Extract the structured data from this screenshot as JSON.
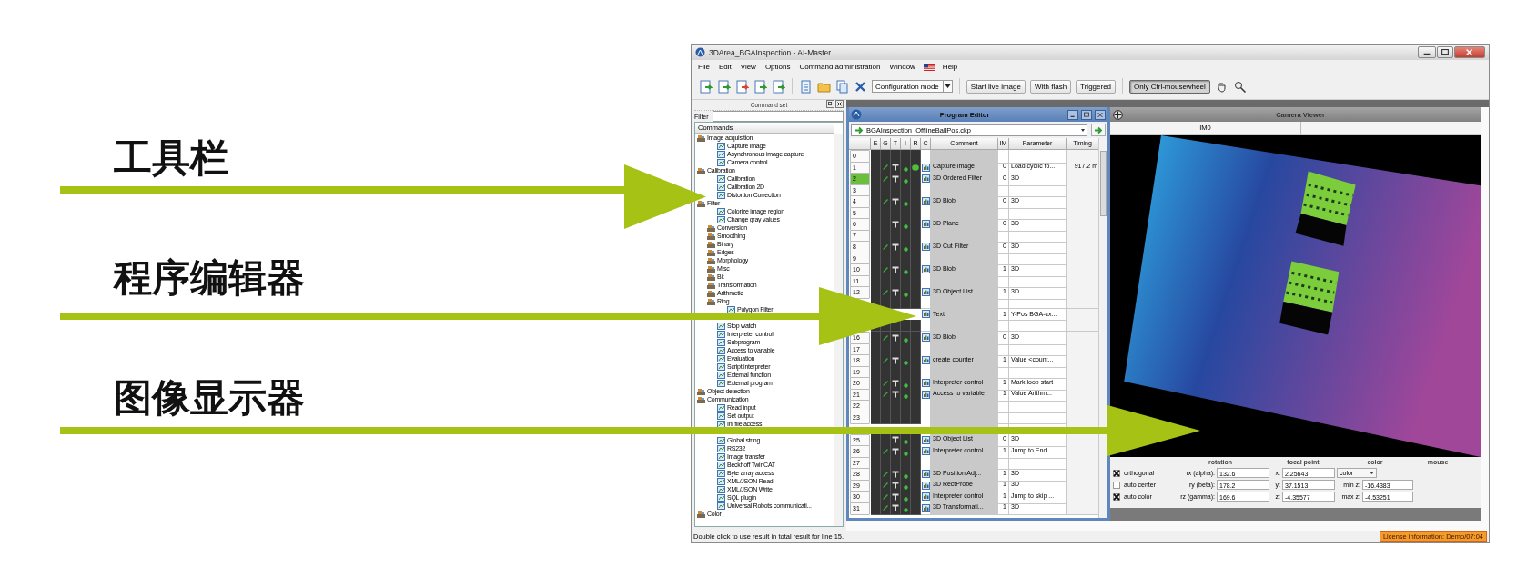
{
  "annotations": [
    {
      "label": "工具栏"
    },
    {
      "label": "程序编辑器"
    },
    {
      "label": "图像显示器"
    }
  ],
  "window": {
    "title": "3DArea_BGAInspection - AI-Master"
  },
  "menu": [
    {
      "kind": "text",
      "label": "File"
    },
    {
      "kind": "text",
      "label": "Edit"
    },
    {
      "kind": "text",
      "label": "View"
    },
    {
      "kind": "text",
      "label": "Options"
    },
    {
      "kind": "text",
      "label": "Command administration"
    },
    {
      "kind": "text",
      "label": "Window"
    },
    {
      "kind": "flag"
    },
    {
      "kind": "text",
      "label": "Help"
    }
  ],
  "toolbar": {
    "mode_select": "Configuration mode",
    "buttons": [
      {
        "label": "Start live image",
        "pressed": false
      },
      {
        "label": "With flash",
        "pressed": false
      },
      {
        "label": "Triggered",
        "pressed": false
      },
      {
        "label": "Only Ctrl-mousewheel",
        "pressed": true
      }
    ]
  },
  "command_panel": {
    "title": "Command set",
    "filter_label": "Filter",
    "tree_header": "Commands",
    "tree": [
      {
        "kind": "category",
        "label": "Image acquisition",
        "children": [
          {
            "kind": "command",
            "label": "Capture image"
          },
          {
            "kind": "command",
            "label": "Asynchronous image capture"
          },
          {
            "kind": "command",
            "label": "Camera control"
          }
        ]
      },
      {
        "kind": "category",
        "label": "Calibration",
        "children": [
          {
            "kind": "command",
            "label": "Calibration"
          },
          {
            "kind": "command",
            "label": "Calibration 2D"
          },
          {
            "kind": "command",
            "label": "Distortion Correction"
          }
        ]
      },
      {
        "kind": "category",
        "label": "Filter",
        "children": [
          {
            "kind": "command",
            "label": "Colorize image region"
          },
          {
            "kind": "command",
            "label": "Change gray values"
          },
          {
            "kind": "category",
            "label": "Conversion"
          },
          {
            "kind": "category",
            "label": "Smoothing"
          },
          {
            "kind": "category",
            "label": "Binary"
          },
          {
            "kind": "category",
            "label": "Edges"
          },
          {
            "kind": "category",
            "label": "Morphology"
          },
          {
            "kind": "category",
            "label": "Misc"
          },
          {
            "kind": "category",
            "label": "Bit"
          },
          {
            "kind": "category",
            "label": "Transformation"
          },
          {
            "kind": "category",
            "label": "Arithmetic"
          },
          {
            "kind": "category",
            "label": "Ring",
            "children": [
              {
                "kind": "command",
                "label": "Polygon Filter"
              }
            ]
          }
        ]
      },
      {
        "kind": "category",
        "children": [
          {
            "kind": "command",
            "label": "Stop watch"
          },
          {
            "kind": "command",
            "label": "Interpreter control"
          },
          {
            "kind": "command",
            "label": "Subprogram"
          },
          {
            "kind": "command",
            "label": "Access to variable"
          },
          {
            "kind": "command",
            "label": "Evaluation"
          },
          {
            "kind": "command",
            "label": "Script interpreter"
          },
          {
            "kind": "command",
            "label": "External function"
          },
          {
            "kind": "command",
            "label": "External program"
          }
        ]
      },
      {
        "kind": "category",
        "label": "Object detection"
      },
      {
        "kind": "category",
        "label": "Communication",
        "children": [
          {
            "kind": "command",
            "label": "Read input"
          },
          {
            "kind": "command",
            "label": "Set output"
          },
          {
            "kind": "command",
            "label": "Ini file access"
          },
          {
            "kind": "command"
          },
          {
            "kind": "command",
            "label": "Global string"
          },
          {
            "kind": "command",
            "label": "RS232"
          },
          {
            "kind": "command",
            "label": "Image transfer"
          },
          {
            "kind": "command",
            "label": "Beckhoff TwinCAT"
          },
          {
            "kind": "command",
            "label": "Byte array access"
          },
          {
            "kind": "command",
            "label": "XML/JSON Read"
          },
          {
            "kind": "command",
            "label": "XML/JSON Write"
          },
          {
            "kind": "command",
            "label": "SQL plugin"
          },
          {
            "kind": "command",
            "label": "Universal Robots communicati..."
          }
        ]
      },
      {
        "kind": "category",
        "label": "Color"
      }
    ]
  },
  "program_editor": {
    "title": "Program Editor",
    "file": "BGAInspection_OfflineBallPos.ckp",
    "columns": [
      "E",
      "G",
      "T",
      "I",
      "R",
      "C",
      "Comment",
      "IM",
      "Parameter",
      "Timing"
    ],
    "rows": [
      {
        "number": "0",
        "selected": false,
        "g": false,
        "t": false,
        "i": false,
        "r": false
      },
      {
        "number": "1",
        "selected": false,
        "g": true,
        "t": true,
        "i": true,
        "r": true,
        "comment": "Capture image",
        "im": "0",
        "parameter": "Load cyclic fo...",
        "timing": "917.2 m"
      },
      {
        "number": "2",
        "selected": true,
        "g": true,
        "t": true,
        "i": true,
        "r": false,
        "comment": "3D Ordered Filter",
        "im": "0",
        "parameter": "3D"
      },
      {
        "number": "3",
        "selected": false,
        "g": false,
        "t": false,
        "i": false,
        "r": false
      },
      {
        "number": "4",
        "selected": false,
        "g": true,
        "t": true,
        "i": true,
        "r": false,
        "comment": "3D Blob",
        "im": "0",
        "parameter": "3D"
      },
      {
        "number": "5",
        "selected": false,
        "g": false,
        "t": false,
        "i": false,
        "r": false
      },
      {
        "number": "6",
        "selected": false,
        "g": false,
        "t": true,
        "i": true,
        "r": false,
        "comment": "3D Plane",
        "im": "0",
        "parameter": "3D"
      },
      {
        "number": "7",
        "selected": false,
        "g": false,
        "t": false,
        "i": false,
        "r": false
      },
      {
        "number": "8",
        "selected": false,
        "g": true,
        "t": true,
        "i": true,
        "r": false,
        "comment": "3D Cut Filter",
        "im": "0",
        "parameter": "3D"
      },
      {
        "number": "9",
        "selected": false,
        "g": false,
        "t": false,
        "i": false,
        "r": false
      },
      {
        "number": "10",
        "selected": false,
        "g": true,
        "t": true,
        "i": true,
        "r": false,
        "comment": "3D Blob",
        "im": "1",
        "parameter": "3D"
      },
      {
        "number": "11",
        "selected": false,
        "g": false,
        "t": false,
        "i": false,
        "r": false
      },
      {
        "number": "12",
        "selected": false,
        "g": true,
        "t": true,
        "i": true,
        "r": false,
        "comment": "3D Object List",
        "im": "1",
        "parameter": "3D"
      },
      {
        "g": false,
        "t": false,
        "i": false,
        "r": false
      },
      {
        "comment": "Text",
        "im": "1",
        "parameter": "Y-Pos BGA-cx..."
      },
      {
        "g": false,
        "t": false,
        "i": false,
        "r": false
      },
      {
        "number": "16",
        "selected": false,
        "g": true,
        "t": true,
        "i": true,
        "r": false,
        "comment": "3D Blob",
        "im": "0",
        "parameter": "3D"
      },
      {
        "number": "17",
        "selected": false,
        "g": false,
        "t": false,
        "i": false,
        "r": false
      },
      {
        "number": "18",
        "selected": false,
        "g": true,
        "t": true,
        "i": true,
        "r": false,
        "comment": "create counter",
        "im": "1",
        "parameter": "Value <count..."
      },
      {
        "number": "19",
        "selected": false,
        "g": false,
        "t": false,
        "i": false,
        "r": false
      },
      {
        "number": "20",
        "selected": false,
        "g": true,
        "t": true,
        "i": true,
        "r": false,
        "comment": "Interpreter control",
        "im": "1",
        "parameter": "Mark loop start"
      },
      {
        "number": "21",
        "selected": false,
        "g": true,
        "t": true,
        "i": true,
        "r": false,
        "comment": "Access to variable",
        "im": "1",
        "parameter": "Value  Arithm..."
      },
      {
        "number": "22",
        "selected": false,
        "g": false,
        "t": false,
        "i": false,
        "r": false
      },
      {
        "number": "23",
        "selected": false,
        "g": false,
        "t": false,
        "i": false,
        "r": false
      },
      {},
      {
        "number": "25",
        "selected": false,
        "g": false,
        "t": true,
        "i": true,
        "r": false,
        "comment": "3D Object List",
        "im": "0",
        "parameter": "3D"
      },
      {
        "number": "26",
        "selected": false,
        "g": true,
        "t": true,
        "i": true,
        "r": false,
        "comment": "Interpreter control",
        "im": "1",
        "parameter": "Jump to End ..."
      },
      {
        "number": "27",
        "selected": false,
        "g": false,
        "t": false,
        "i": false,
        "r": false
      },
      {
        "number": "28",
        "selected": false,
        "g": true,
        "t": true,
        "i": true,
        "r": false,
        "comment": "3D Position Adj...",
        "im": "1",
        "parameter": "3D"
      },
      {
        "number": "29",
        "selected": false,
        "g": true,
        "t": true,
        "i": true,
        "r": false,
        "comment": "3D RectProbe",
        "im": "1",
        "parameter": "3D"
      },
      {
        "number": "30",
        "selected": false,
        "g": true,
        "t": true,
        "i": true,
        "r": false,
        "comment": "Interpreter control",
        "im": "1",
        "parameter": "Jump to skip ..."
      },
      {
        "number": "31",
        "selected": false,
        "g": true,
        "t": true,
        "i": true,
        "r": false,
        "comment": "3D Transformati...",
        "im": "1",
        "parameter": "3D"
      }
    ]
  },
  "camera_viewer": {
    "title": "Camera Viewer",
    "tab": "IM0",
    "headers": [
      "rotation",
      "focal point",
      "color",
      "mouse"
    ],
    "options": [
      {
        "label": "orthogonal",
        "checked": true
      },
      {
        "label": "auto center",
        "checked": false
      },
      {
        "label": "auto color",
        "checked": true
      }
    ],
    "rotation": [
      {
        "label": "rx (alpha):",
        "value": "132.6"
      },
      {
        "label": "ry (beta):",
        "value": "178.2"
      },
      {
        "label": "rz (gamma):",
        "value": "169.6"
      }
    ],
    "focal_point": [
      {
        "label": "x:",
        "value": "2.25643"
      },
      {
        "label": "y:",
        "value": "37.1513"
      },
      {
        "label": "z:",
        "value": "-4.35577"
      }
    ],
    "color_select": "color",
    "z_range": [
      {
        "label": "min z:",
        "value": "-16.4383"
      },
      {
        "label": "max z:",
        "value": "-4.53251"
      }
    ]
  },
  "status_bar": {
    "message": "Double click to use result in total result for line 15.",
    "license": "License information: Demo/07:04"
  }
}
